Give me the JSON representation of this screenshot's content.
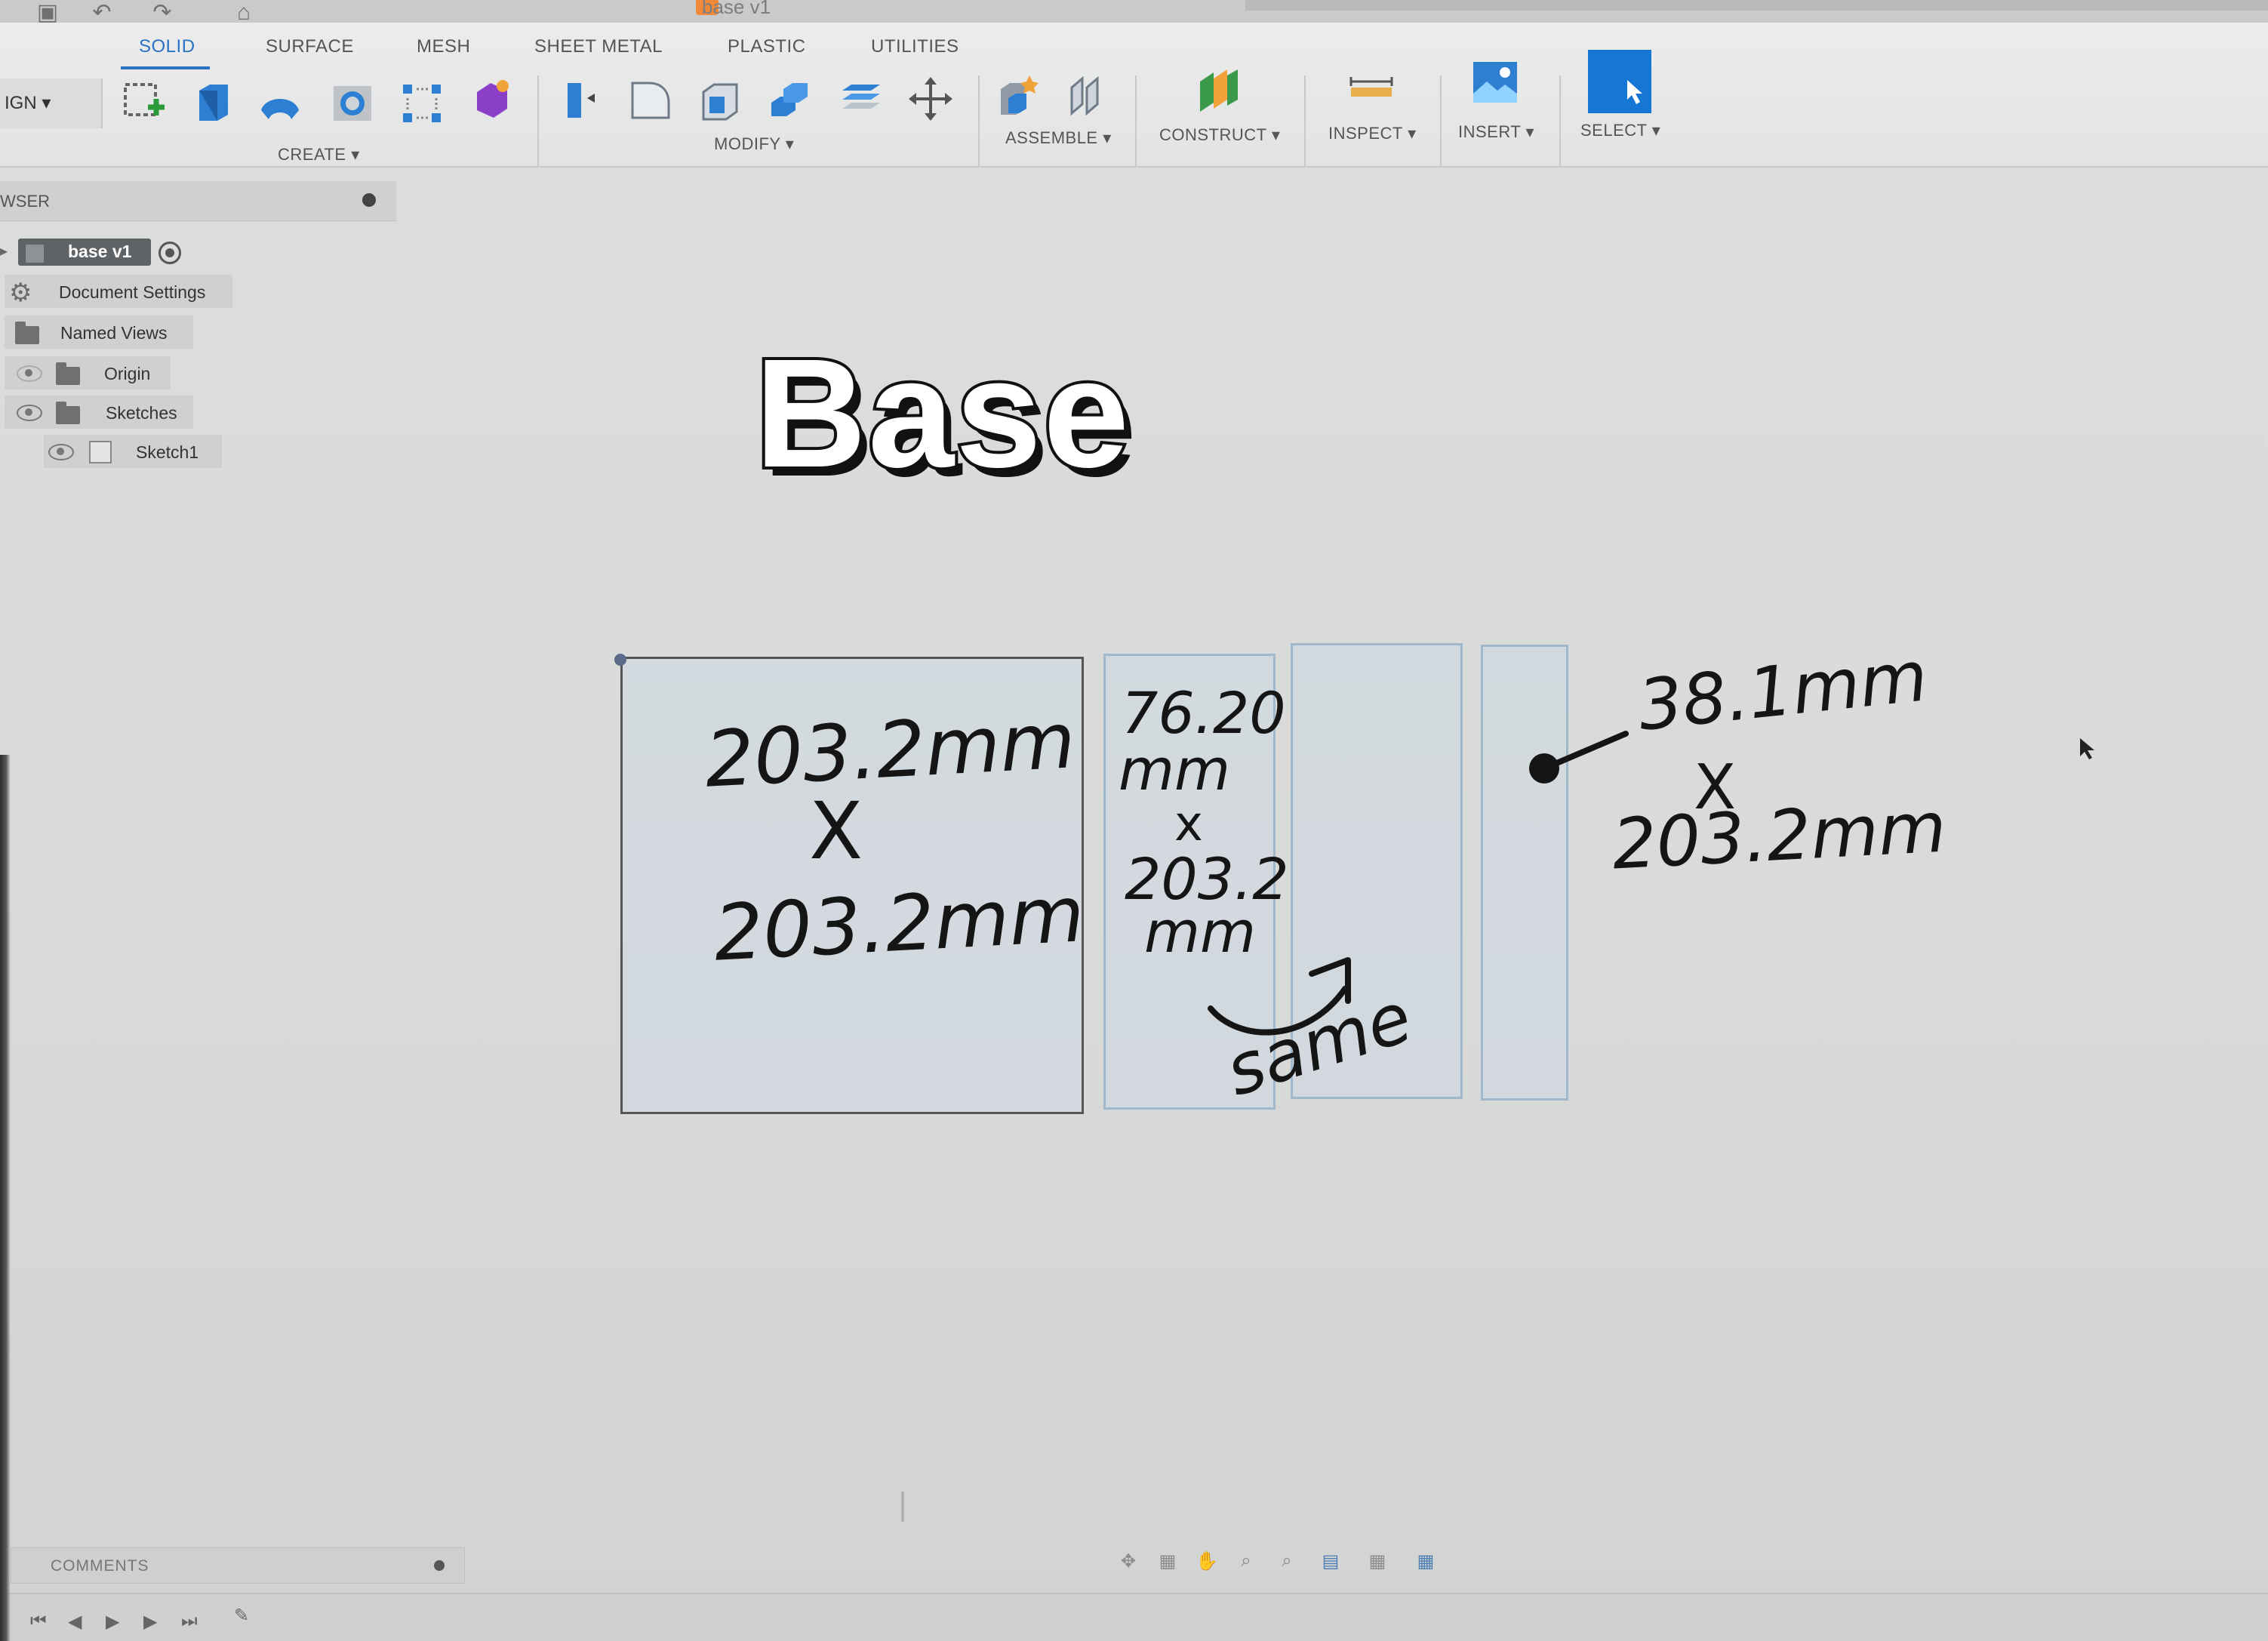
{
  "window": {
    "document_title": "base v1"
  },
  "toolbar": {
    "design_menu": "IGN",
    "tabs": [
      "SOLID",
      "SURFACE",
      "MESH",
      "SHEET METAL",
      "PLASTIC",
      "UTILITIES"
    ],
    "active_tab": "SOLID",
    "groups": {
      "create": "CREATE",
      "modify": "MODIFY",
      "assemble": "ASSEMBLE",
      "construct": "CONSTRUCT",
      "inspect": "INSPECT",
      "insert": "INSERT",
      "select": "SELECT"
    }
  },
  "browser": {
    "title": "WSER",
    "root": "base v1",
    "items": [
      "Document Settings",
      "Named Views",
      "Origin",
      "Sketches",
      "Sketch1"
    ]
  },
  "canvas": {
    "overlay_title": "Base",
    "annotations": {
      "square": {
        "w": "203.2mm",
        "x": "X",
        "h": "203.2mm"
      },
      "middle": {
        "line1": "76.20",
        "line2": "mm",
        "x": "x",
        "line3": "203.2",
        "line4": "mm"
      },
      "same": "same",
      "thin": {
        "w": "38.1mm",
        "x": "X",
        "h": "203.2mm"
      }
    }
  },
  "comments": {
    "label": "COMMENTS"
  },
  "colors": {
    "accent": "#2a73c4",
    "sketch_fill": "#cdd8e2",
    "sketch_edge": "#9fb8cc"
  }
}
